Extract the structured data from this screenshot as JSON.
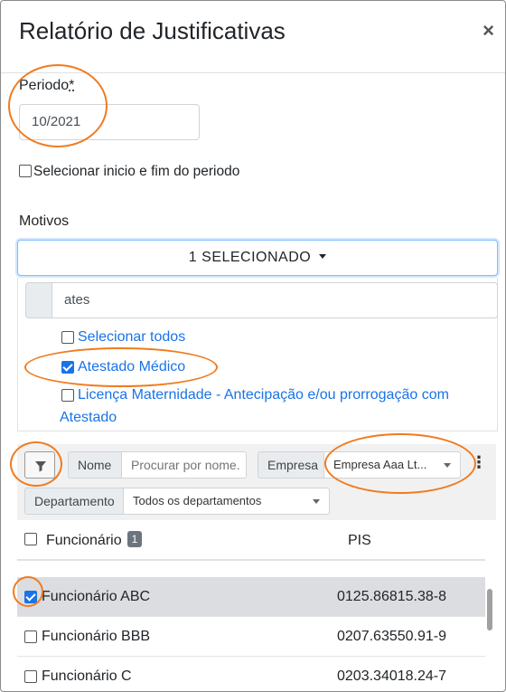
{
  "modal": {
    "title": "Relatório de Justificativas",
    "close_icon": "×"
  },
  "periodo": {
    "label": "Periodo",
    "required_mark": "*",
    "value": "10/2021",
    "range_checkbox_label": "Selecionar inicio e fim do periodo",
    "range_checked": false
  },
  "motivos": {
    "label": "Motivos",
    "dropdown_label": "1 SELECIONADO",
    "search_value": "ates",
    "select_all_label": "Selecionar todos",
    "options": [
      {
        "label": "Atestado Médico",
        "checked": true
      },
      {
        "label": "Licença Maternidade - Antecipação e/ou prorrogação com",
        "label_line2": "Atestado",
        "checked": false
      }
    ]
  },
  "filters": {
    "filter_icon": "filter-icon",
    "nome_label": "Nome",
    "nome_placeholder": "Procurar por nome.",
    "empresa_label": "Empresa",
    "empresa_value": "Empresa Aaa Lt...",
    "more_icon": "⋮",
    "departamento_label": "Departamento",
    "departamento_value": "Todos os departamentos"
  },
  "table": {
    "columns": [
      "Funcionário",
      "PIS"
    ],
    "selected_count": "1",
    "rows": [
      {
        "name": "Funcionário ABC",
        "pis": "0125.86815.38-8",
        "checked": true
      },
      {
        "name": "Funcionário BBB",
        "pis": "0207.63550.91-9",
        "checked": false
      },
      {
        "name": "Funcionário C",
        "pis": "0203.34018.24-7",
        "checked": false
      }
    ]
  },
  "colors": {
    "accent": "#1a73e8",
    "highlight_ring": "#f07b1f",
    "selected_row": "#dcdde0"
  }
}
